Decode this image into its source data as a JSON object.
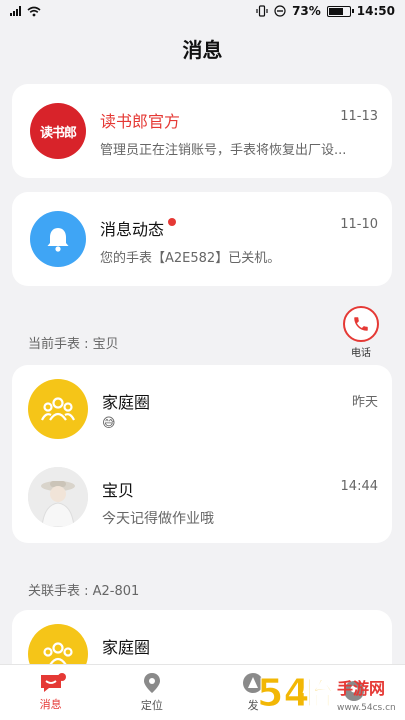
{
  "status_bar": {
    "battery": "73%",
    "time": "14:50",
    "battery_level": 0.73
  },
  "header": {
    "title": "消息"
  },
  "official": {
    "logo_text": "读书郎",
    "name": "读书郎官方",
    "preview": "管理员正在注销账号，手表将恢复出厂设...",
    "time": "11-13",
    "name_color": "#e53935"
  },
  "dynamics": {
    "name": "消息动态",
    "preview": "您的手表【A2E582】已关机。",
    "time": "11-10",
    "icon": "bell-icon"
  },
  "call": {
    "label": "电话",
    "icon": "phone-icon"
  },
  "current_watch": {
    "label": "当前手表 : 宝贝",
    "chats": [
      {
        "name": "家庭圈",
        "preview": "😅",
        "time": "昨天",
        "icon": "group-icon"
      },
      {
        "name": "宝贝",
        "preview": "今天记得做作业哦",
        "time": "14:44",
        "icon": "photo-avatar"
      }
    ]
  },
  "linked_watch": {
    "label": "关联手表 : A2-801",
    "chats": [
      {
        "name": "家庭圈",
        "icon": "group-icon"
      }
    ]
  },
  "tabs": [
    {
      "label": "消息",
      "icon": "message-icon",
      "active": true
    },
    {
      "label": "定位",
      "icon": "location-icon",
      "active": false
    },
    {
      "label": "发",
      "icon": "discover-icon",
      "active": false
    },
    {
      "label": "",
      "icon": "profile-icon",
      "active": false
    }
  ],
  "watermark": {
    "text": "54怡手游网",
    "url": "www.54cs.cn"
  },
  "colors": {
    "accent": "#e53935",
    "yellow": "#f5c518",
    "blue": "#3fa5f5"
  }
}
